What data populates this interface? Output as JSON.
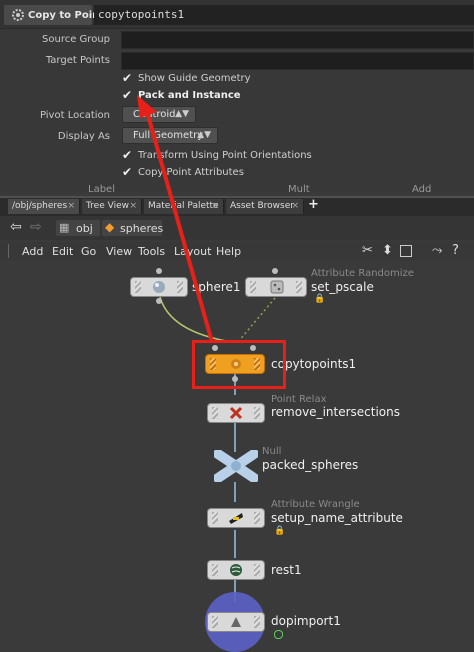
{
  "params": {
    "node_type": "Copy to Points",
    "node_name": "copytopoints1",
    "source_group_label": "Source Group",
    "target_points_label": "Target Points",
    "show_guide_label": "Show Guide Geometry",
    "pack_instance_label": "Pack and Instance",
    "pivot_label": "Pivot Location",
    "pivot_value": "Centroid",
    "display_as_label": "Display As",
    "display_as_value": "Full Geometry",
    "transform_label": "Transform Using Point Orientations",
    "copy_attr_label": "Copy Point Attributes",
    "col_label": "Label",
    "col_mult": "Mult",
    "col_add": "Add"
  },
  "tabs": [
    "/obj/spheres",
    "Tree View",
    "Material Palette",
    "Asset Browser",
    "+"
  ],
  "path": {
    "root": "obj",
    "current": "spheres"
  },
  "menu": [
    "Add",
    "Edit",
    "Go",
    "View",
    "Tools",
    "Layout",
    "Help"
  ],
  "nodes": {
    "sphere": {
      "name": "sphere1"
    },
    "set_pscale": {
      "type": "Attribute Randomize",
      "name": "set_pscale"
    },
    "copytopoints": {
      "name": "copytopoints1"
    },
    "remove": {
      "type": "Point Relax",
      "name": "remove_intersections"
    },
    "packed": {
      "type": "Null",
      "name": "packed_spheres"
    },
    "setup": {
      "type": "Attribute Wrangle",
      "name": "setup_name_attribute"
    },
    "rest": {
      "name": "rest1"
    },
    "dopimport": {
      "name": "dopimport1"
    }
  },
  "colors": {
    "highlight": "#e8201a",
    "selected_node": "#f0a020",
    "wire": "#7fa0b8"
  }
}
